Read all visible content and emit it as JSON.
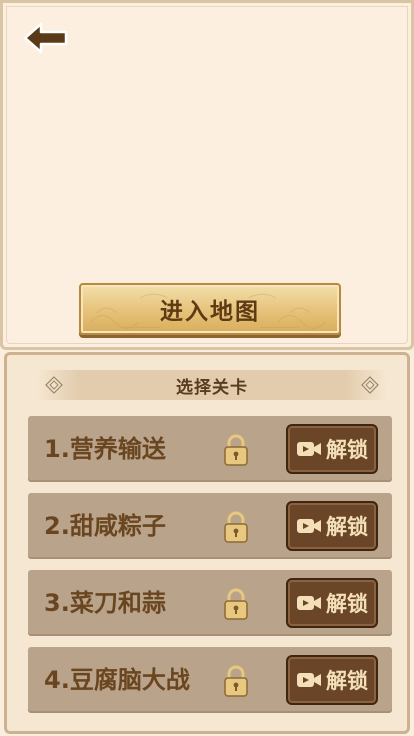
{
  "enter_map": {
    "label": "进入地图"
  },
  "panel": {
    "title": "选择关卡"
  },
  "levels": [
    {
      "name": "1.营养输送",
      "action_label": "解锁"
    },
    {
      "name": "2.甜咸粽子",
      "action_label": "解锁"
    },
    {
      "name": "3.菜刀和蒜",
      "action_label": "解锁"
    },
    {
      "name": "4.豆腐脑大战",
      "action_label": "解锁"
    }
  ]
}
